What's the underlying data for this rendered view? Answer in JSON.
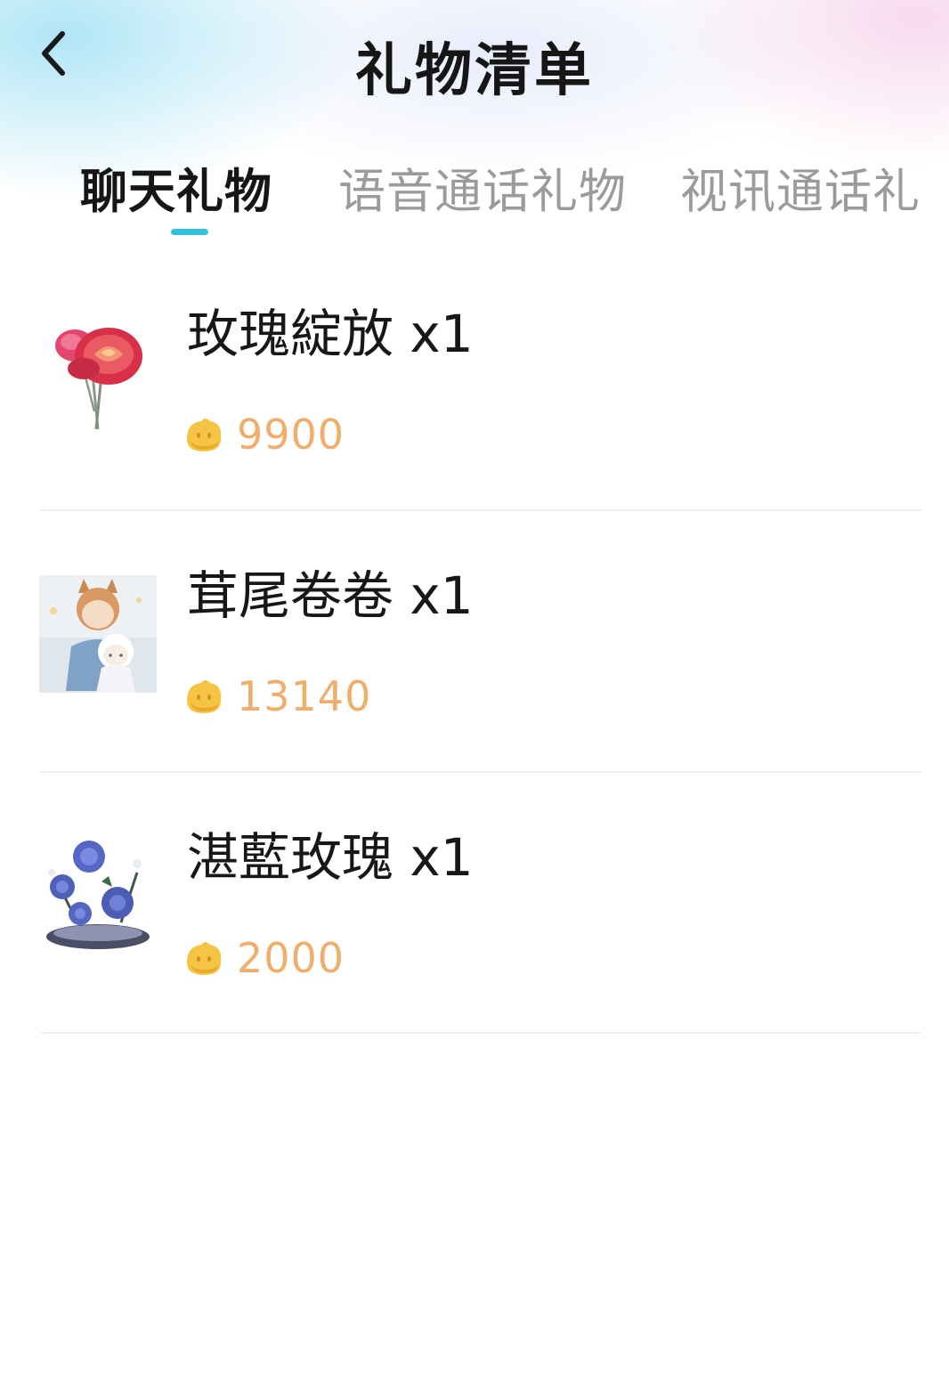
{
  "header": {
    "title": "礼物清单",
    "back_icon": "chevron-left-icon"
  },
  "tabs": [
    {
      "label": "聊天礼物",
      "active": true
    },
    {
      "label": "语音通话礼物",
      "active": false
    },
    {
      "label": "视讯通话礼",
      "active": false
    }
  ],
  "colors": {
    "accent": "#32c3dc",
    "price": "#efae6c",
    "coin": "#f6c445",
    "divider": "#ececec",
    "inactive_tab": "#9b9b9b"
  },
  "gifts": [
    {
      "name": "玫瑰綻放 x1",
      "price": "9900",
      "icon": "red-rose-icon",
      "currency_icon": "coin-icon"
    },
    {
      "name": "茸尾卷卷 x1",
      "price": "13140",
      "icon": "anime-couple-icon",
      "currency_icon": "coin-icon"
    },
    {
      "name": "湛藍玫瑰 x1",
      "price": "2000",
      "icon": "blue-rose-bouquet-icon",
      "currency_icon": "coin-icon"
    }
  ]
}
